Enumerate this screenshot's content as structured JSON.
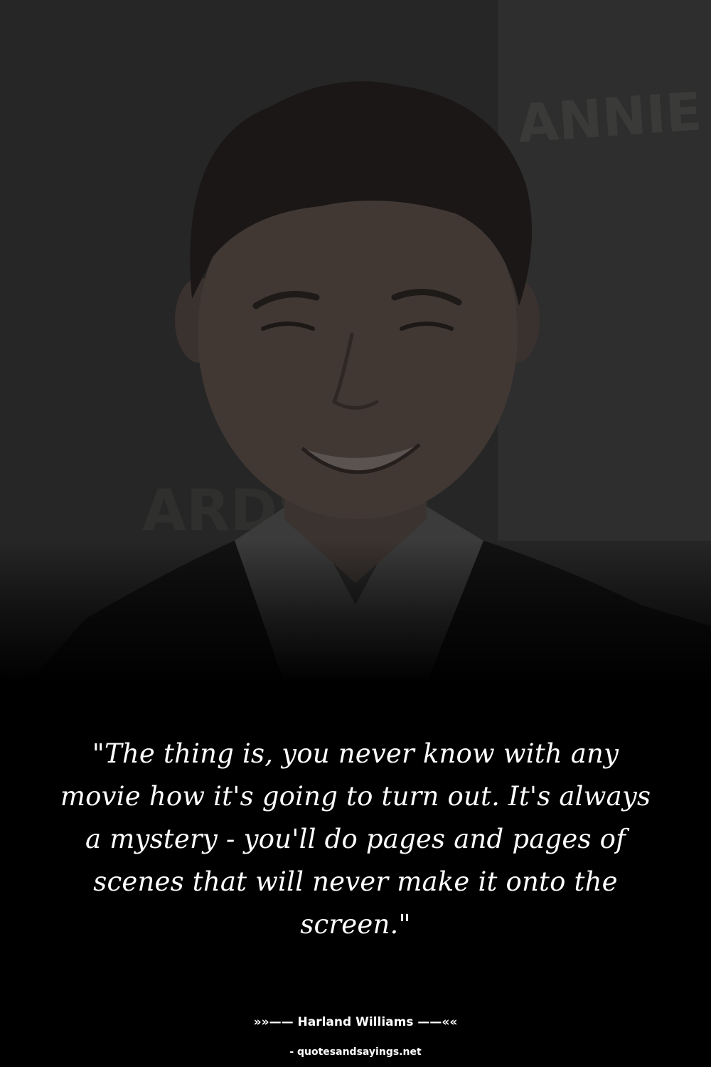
{
  "photo": {
    "subject": "portrait of smiling man in dark suit and white shirt",
    "background_sign_text_top": "ANNIE A",
    "background_sign_text_bottom": "ARDS"
  },
  "quote": {
    "text": "\"The thing is, you never know with any movie how it's going to turn out. It's always a mystery - you'll do pages and pages of scenes that will never make it onto the screen.\""
  },
  "attribution": {
    "text": "»»—— Harland Williams ——««"
  },
  "source": {
    "text": "- quotesandsayings.net"
  },
  "colors": {
    "background": "#000000",
    "text": "#ffffff"
  }
}
